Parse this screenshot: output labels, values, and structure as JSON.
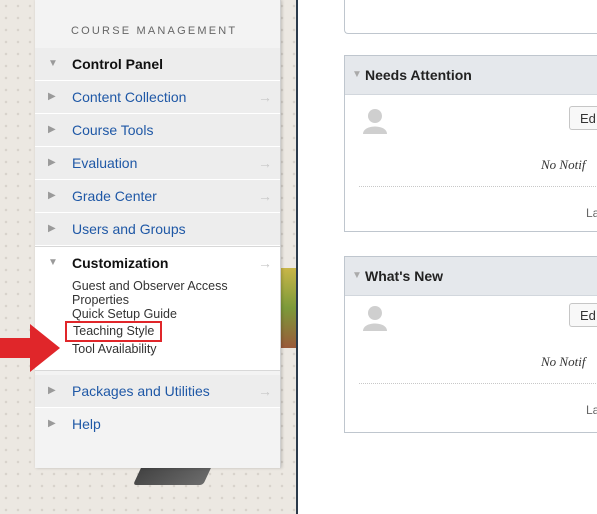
{
  "menu": {
    "header": "COURSE MANAGEMENT",
    "control_panel": "Control Panel",
    "items": [
      {
        "label": "Content Collection",
        "arrow": "→"
      },
      {
        "label": "Course Tools",
        "arrow": ""
      },
      {
        "label": "Evaluation",
        "arrow": "→"
      },
      {
        "label": "Grade Center",
        "arrow": "→"
      },
      {
        "label": "Users and Groups",
        "arrow": ""
      }
    ],
    "customization": {
      "label": "Customization",
      "arrow": "→",
      "sub_items": [
        "Guest and Observer Access",
        "Properties",
        "Quick Setup Guide",
        "Teaching Style",
        "Tool Availability"
      ]
    },
    "bottom_items": [
      {
        "label": "Packages and Utilities",
        "arrow": "→"
      },
      {
        "label": "Help",
        "arrow": ""
      }
    ]
  },
  "panels": [
    {
      "title": "Needs Attention",
      "edit": "Ed",
      "empty": "No Notif",
      "footer": "La"
    },
    {
      "title": "What's New",
      "edit": "Ed",
      "empty": "No Notif",
      "footer": "La"
    }
  ],
  "colors": {
    "link": "#1f58a6",
    "highlight": "#e0262a",
    "arrow": "#e0262a"
  }
}
